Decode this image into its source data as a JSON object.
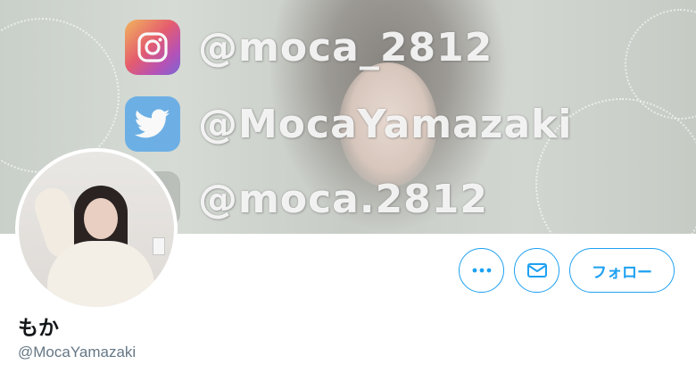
{
  "banner": {
    "handles": [
      {
        "platform_icon": "instagram-icon",
        "text": "@moca_2812"
      },
      {
        "platform_icon": "twitter-icon",
        "text": "@MocaYamazaki"
      },
      {
        "platform_icon": "tiktok-icon",
        "text": "@moca.2812"
      }
    ]
  },
  "profile": {
    "display_name": "もか",
    "screen_name": "@MocaYamazaki"
  },
  "actions": {
    "more_icon": "more-icon",
    "message_icon": "mail-icon",
    "follow_label": "フォロー"
  },
  "colors": {
    "accent": "#1da1f2",
    "name_text": "#14171a",
    "secondary_text": "#657786"
  }
}
